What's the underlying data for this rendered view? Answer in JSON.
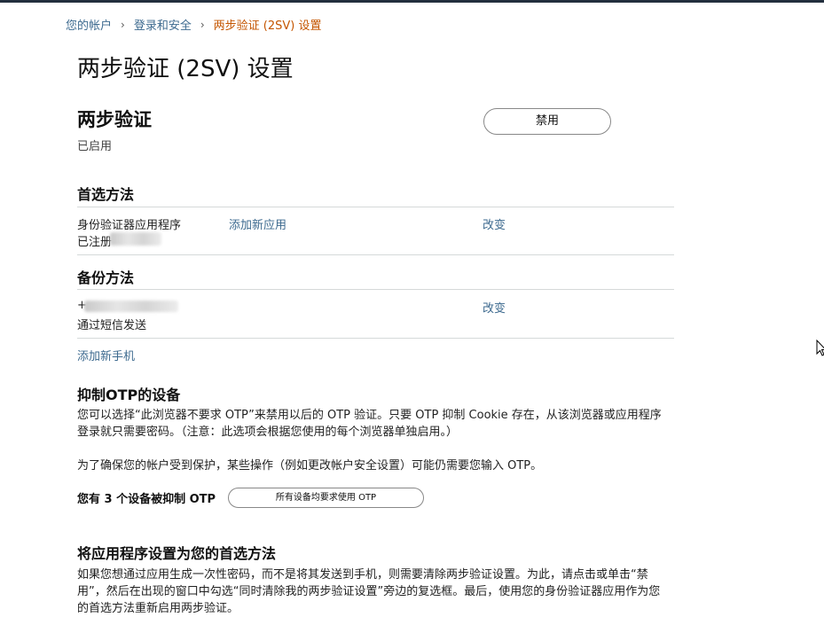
{
  "breadcrumb": {
    "items": [
      "您的帐户",
      "登录和安全"
    ],
    "separator": "›",
    "current": "两步验证 (2SV) 设置"
  },
  "page_title": "两步验证 (2SV) 设置",
  "two_step": {
    "heading": "两步验证",
    "status": "已启用",
    "disable_button": "禁用"
  },
  "preferred": {
    "heading": "首选方法",
    "method_name": "身份验证器应用程序",
    "registered_label": "已注册",
    "add_app_link": "添加新应用",
    "change_link": "改变"
  },
  "backup": {
    "heading": "备份方法",
    "phone_prefix": "+",
    "delivery": "通过短信发送",
    "change_link": "改变",
    "add_phone_link": "添加新手机"
  },
  "otp": {
    "heading": "抑制OTP的设备",
    "paragraph_line1": "您可以选择“此浏览器不要求 OTP”来禁用以后的 OTP 验证。只要 OTP 抑制 Cookie 存在，从该浏览器或应用程序",
    "paragraph_line2": "登录就只需要密码。（注意：此选项会根据您使用的每个浏览器单独启用。）",
    "protection_note": "为了确保您的帐户受到保护，某些操作（例如更改帐户安全设置）可能仍需要您输入 OTP。",
    "suppressed_count_label": "您有 3 个设备被抑制 OTP",
    "require_all_button": "所有设备均要求使用 OTP"
  },
  "app_preferred": {
    "heading": "将应用程序设置为您的首选方法",
    "line1": "如果您想通过应用生成一次性密码，而不是将其发送到手机，则需要清除两步验证设置。为此，请点击或单击“禁",
    "line2": "用”，然后在出现的窗口中勾选“同时清除我的两步验证设置”旁边的复选框。最后，使用您的身份验证器应用作为您",
    "line3": "的首选方法重新启用两步验证。"
  },
  "icons": {
    "separator": "chevron-right-icon",
    "cursor": "mouse-cursor-icon"
  },
  "colors": {
    "link": "#3d6a8f",
    "breadcrumb_current": "#c45500",
    "top_bar": "#232f3e",
    "divider": "#d5d9d9"
  }
}
